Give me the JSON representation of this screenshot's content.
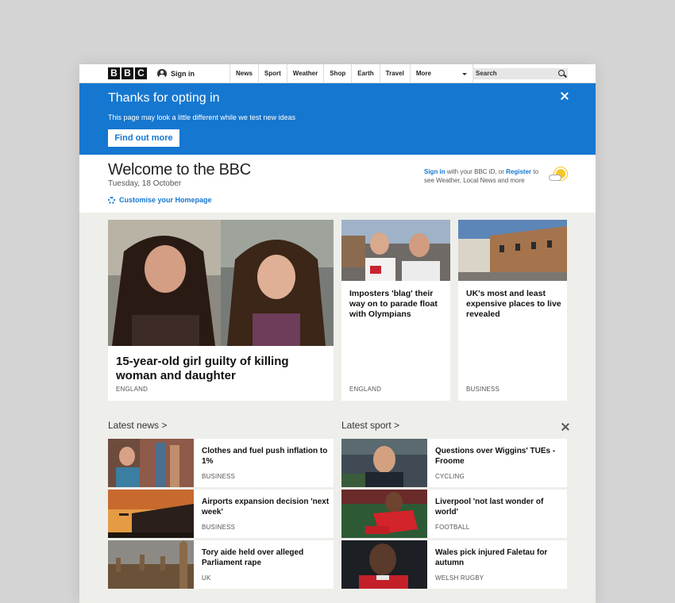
{
  "nav": {
    "logo": [
      "B",
      "B",
      "C"
    ],
    "signin": "Sign in",
    "links": [
      "News",
      "Sport",
      "Weather",
      "Shop",
      "Earth",
      "Travel"
    ],
    "more": "More",
    "search_placeholder": "Search"
  },
  "banner": {
    "title": "Thanks for opting in",
    "text": "This page may look a little different while we test new ideas",
    "button": "Find out more"
  },
  "welcome": {
    "title": "Welcome to the BBC",
    "date": "Tuesday, 18 October",
    "customise": "Customise your Homepage",
    "signin_link": "Sign in",
    "account_mid": " with your BBC iD, or ",
    "register_link": "Register",
    "account_tail": " to see Weather, Local News and more"
  },
  "top_stories": [
    {
      "headline": "15-year-old girl guilty of killing woman and daughter",
      "tag": "England"
    },
    {
      "headline": "Imposters 'blag' their way on to parade float with Olympians",
      "tag": "England"
    },
    {
      "headline": "UK's most and least expensive places to live revealed",
      "tag": "Business"
    }
  ],
  "latest_news": {
    "title": "Latest news >",
    "items": [
      {
        "headline": "Clothes and fuel push inflation to 1%",
        "tag": "Business"
      },
      {
        "headline": "Airports expansion decision 'next week'",
        "tag": "Business"
      },
      {
        "headline": "Tory aide held over alleged Parliament rape",
        "tag": "UK"
      }
    ]
  },
  "latest_sport": {
    "title": "Latest sport >",
    "items": [
      {
        "headline": "Questions over Wiggins' TUEs - Froome",
        "tag": "Cycling"
      },
      {
        "headline": "Liverpool 'not last wonder of world'",
        "tag": "Football"
      },
      {
        "headline": "Wales pick injured Faletau for autumn",
        "tag": "Welsh Rugby"
      }
    ]
  },
  "colors": {
    "accent": "#1577d0",
    "page_bg": "#eeeeea"
  }
}
